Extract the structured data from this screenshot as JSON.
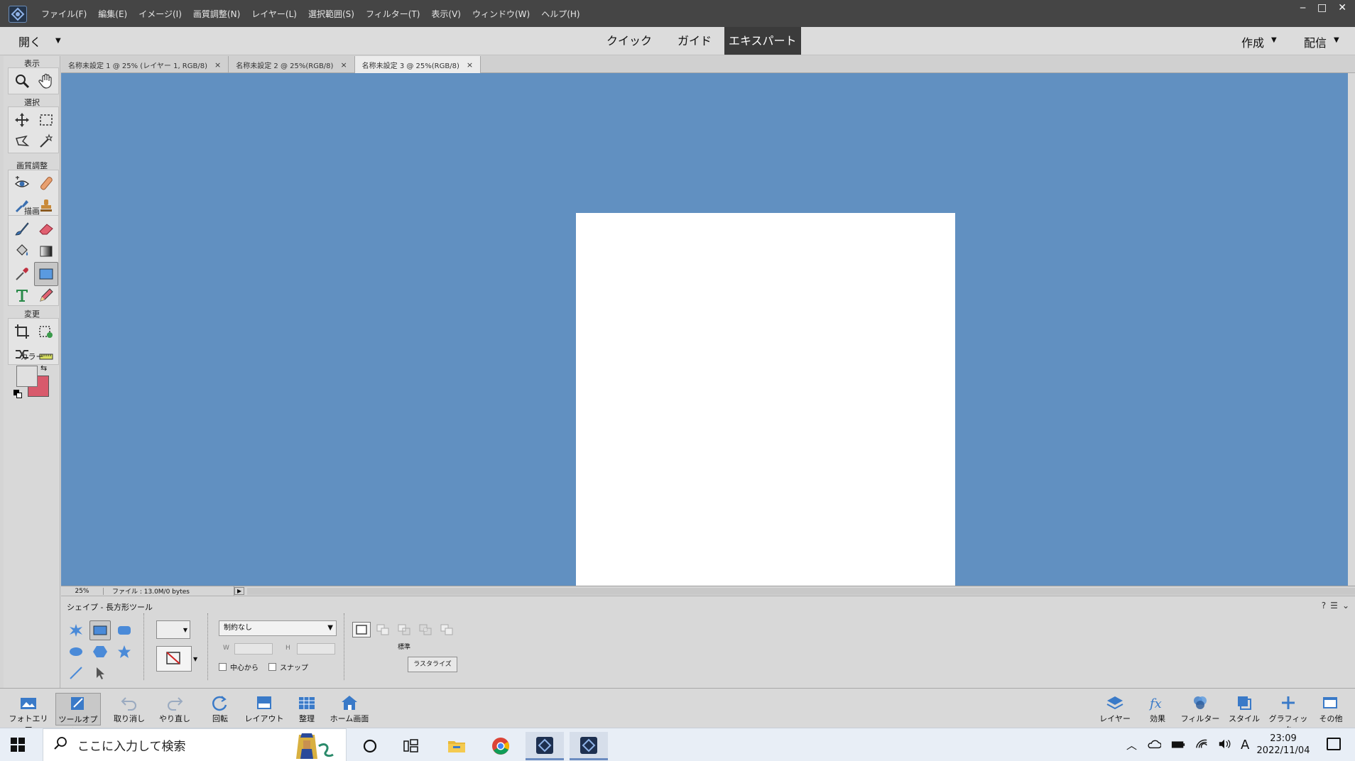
{
  "menubar": {
    "items": [
      "ファイル(F)",
      "編集(E)",
      "イメージ(I)",
      "画質調整(N)",
      "レイヤー(L)",
      "選択範囲(S)",
      "フィルター(T)",
      "表示(V)",
      "ウィンドウ(W)",
      "ヘルプ(H)"
    ]
  },
  "window_controls": {
    "minimize": "‒",
    "maximize": "□",
    "close": "✕"
  },
  "modebar": {
    "open_label": "開く",
    "modes": [
      "クイック",
      "ガイド",
      "エキスパート"
    ],
    "active_mode": "エキスパート",
    "create_label": "作成",
    "share_label": "配信"
  },
  "toolbox": {
    "sections": {
      "view": "表示",
      "select": "選択",
      "enhance": "画質調整",
      "draw": "描画",
      "modify": "変更",
      "color": "カラー"
    },
    "foreground_color": "#e0e0e0",
    "background_color": "#d85a6c"
  },
  "doc_tabs": [
    {
      "label": "名称未設定 1 @ 25% (レイヤー 1, RGB/8)",
      "close": "×"
    },
    {
      "label": "名称未設定 2 @ 25%(RGB/8)",
      "close": "×"
    },
    {
      "label": "名称未設定 3 @ 25%(RGB/8)",
      "close": "×"
    }
  ],
  "status": {
    "zoom": "25%",
    "file_info": "ファイル : 13.0M/0 bytes"
  },
  "options": {
    "title": "シェイプ - 長方形ツール",
    "constraint_value": "制約なし",
    "w_label": "W",
    "h_label": "H",
    "from_center_label": "中心から",
    "snap_label": "スナップ",
    "combine_label": "標準",
    "rasterize_label": "ラスタライズ",
    "help": "?"
  },
  "bottom_bar": {
    "left": [
      "フォトエリア",
      "ツールオプシ...",
      "取り消し",
      "やり直し",
      "回転",
      "レイアウト",
      "整理",
      "ホーム画面"
    ],
    "right": [
      "レイヤー",
      "効果",
      "フィルター",
      "スタイル",
      "グラフィック",
      "その他"
    ]
  },
  "taskbar": {
    "search_placeholder": "ここに入力して検索",
    "ime_indicator": "A",
    "time": "23:09",
    "date": "2022/11/04"
  },
  "colors": {
    "canvas_bg": "#6190c1",
    "title_bar": "#454545",
    "accent": "#3b3b3b"
  }
}
